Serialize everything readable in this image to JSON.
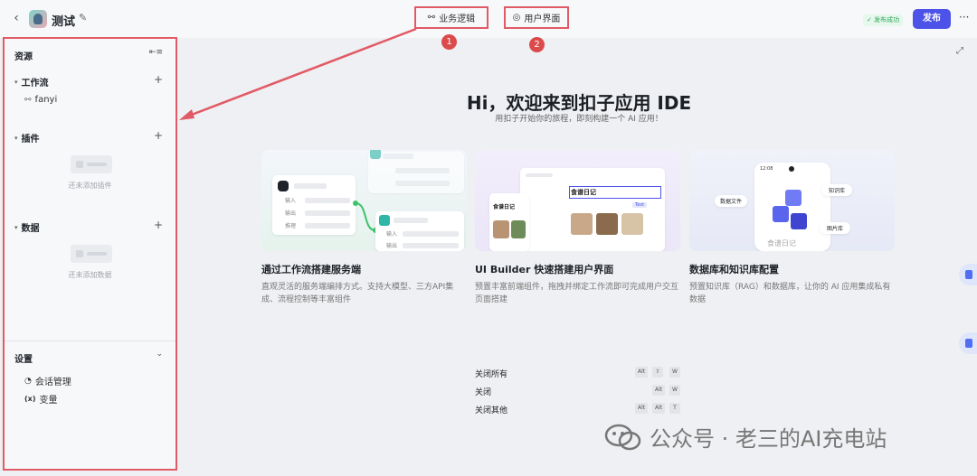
{
  "header": {
    "app_title": "测试",
    "tabs": [
      {
        "label": "业务逻辑",
        "num": "1"
      },
      {
        "label": "用户界面",
        "num": "2"
      }
    ],
    "status": "发布成功",
    "publish_label": "发布"
  },
  "sidebar": {
    "title": "资源",
    "sections": [
      {
        "label": "工作流",
        "items": [
          "fanyi"
        ]
      },
      {
        "label": "插件",
        "empty": "还未添加插件"
      },
      {
        "label": "数据",
        "empty": "还未添加数据"
      }
    ],
    "settings": {
      "label": "设置",
      "items": [
        "会话管理",
        "变量"
      ]
    }
  },
  "main": {
    "title": "Hi，欢迎来到扣子应用 IDE",
    "subtitle": "用扣子开始你的旅程，即刻构建一个 AI 应用！",
    "cards": [
      {
        "title": "通过工作流搭建服务端",
        "desc": "直观灵活的服务端编排方式。支持大模型、三方API集成、流程控制等丰富组件"
      },
      {
        "title": "UI Builder 快速搭建用户界面",
        "desc": "预置丰富前端组件，拖拽并绑定工作流即可完成用户交互页面搭建"
      },
      {
        "title": "数据库和知识库配置",
        "desc": "预置知识库（RAG）和数据库，让你的 AI 应用集成私有数据"
      }
    ],
    "illustrations": {
      "c1": {
        "input": "输入",
        "output": "输出",
        "infer": "推理"
      },
      "c2": {
        "app_title": "食谱日记",
        "tag": "Text"
      },
      "c3": {
        "phone_title": "食谱日记",
        "time": "12:08",
        "tags": [
          "数据文件",
          "知识库",
          "图片库"
        ]
      }
    },
    "shortcuts": [
      {
        "label": "关闭所有",
        "keys": [
          "Alt",
          "⇧",
          "W"
        ]
      },
      {
        "label": "关闭",
        "keys": [
          "Alt",
          "W"
        ]
      },
      {
        "label": "关闭其他",
        "keys": [
          "Alt",
          "Alt",
          "T"
        ]
      }
    ]
  },
  "watermark": "公众号 · 老三的AI充电站",
  "colors": {
    "accent": "#4d53e8",
    "annotation": "#e25a66"
  }
}
